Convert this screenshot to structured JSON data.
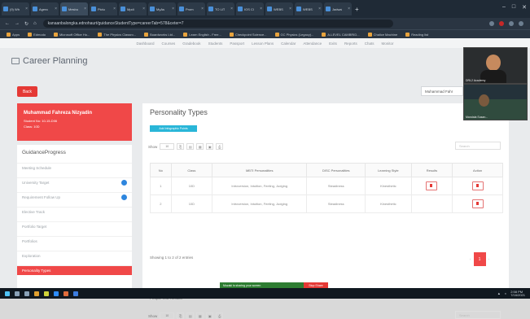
{
  "browser": {
    "tabs": [
      {
        "title": "(9) Wh"
      },
      {
        "title": "Agenc"
      },
      {
        "title": "Mesbu"
      },
      {
        "title": "Pictu"
      },
      {
        "title": "Mpdi"
      },
      {
        "title": "MyAs"
      },
      {
        "title": "Prom"
      },
      {
        "title": "TO LIT"
      },
      {
        "title": "IOS Cl"
      },
      {
        "title": "WEBS"
      },
      {
        "title": "WEBS"
      },
      {
        "title": "Jadwal"
      }
    ],
    "url": "kanaanbalongka.ednohaurt/guidanceStudentType=careerTab=578&ceter=7",
    "bookmarks": [
      "Apps",
      "Edmodo",
      "Microsoft Office Ho...",
      "The Physics Classro...",
      "Boardworks Ltd...",
      "Learn English - Free...",
      "Checkpoint Science...",
      "GC Physics (Legacy)...",
      "A-LEVEL CAMBRID...",
      "Chalice Machine",
      "Reading list"
    ]
  },
  "topnav": [
    "Dashboard",
    "Courses",
    "Gradebook",
    "Students",
    "Passport",
    "Lesson Plans",
    "Calendar",
    "Attendance",
    "Exits",
    "Reports",
    "Chats",
    "Monitor"
  ],
  "page": {
    "title": "Career Planning",
    "back_label": "Back",
    "user_select": "Muhammad Fahr"
  },
  "profile": {
    "name": "Muhammad Fahreza Nizyadin",
    "student_id": "Student No: 10-15-D06",
    "class": "Class: 10D"
  },
  "sidebar": {
    "title": "GuidanceProgress",
    "items": [
      {
        "label": "Meeting Schedule"
      },
      {
        "label": "University Target"
      },
      {
        "label": "Requirement Follow Up"
      },
      {
        "label": "Elective Track"
      },
      {
        "label": "Portfolio Target"
      },
      {
        "label": "Portfolios"
      },
      {
        "label": "Exploration"
      },
      {
        "label": "Personality Types"
      }
    ]
  },
  "personality": {
    "title": "Personality Types",
    "add_label": "Add Infographic Points",
    "show_label": "Show",
    "show_value": "10",
    "search_placeholder": "Search",
    "columns": [
      "No",
      "Class",
      "MBTI Personalities",
      "DISC Personalities",
      "Learning Style",
      "Results",
      "Action"
    ],
    "rows": [
      {
        "no": "1",
        "class": "10D",
        "mbti": "Introversion, Intuition, Feeling, Judging",
        "disc": "Steadiness",
        "learning": "Kinesthetic"
      },
      {
        "no": "2",
        "class": "10D",
        "mbti": "Introversion, Intuition, Feeling, Judging",
        "disc": "Steadiness",
        "learning": "Kinesthetic"
      }
    ],
    "showing_text": "Showing 1 to 2 of 2 entries",
    "page": "1"
  },
  "people_test": {
    "title": "People Test Results",
    "show_label": "Show",
    "show_value": "10",
    "search_placeholder": "Search"
  },
  "video": {
    "tile1_name": "DRL2 Academy",
    "tile2_name": "Mandala Susan..."
  },
  "recording": {
    "text": "Muzaki is sharing your screen",
    "stop_label": "Stop Share"
  },
  "taskbar": {
    "time": "2:58 PM",
    "date": "7/16/2021"
  }
}
